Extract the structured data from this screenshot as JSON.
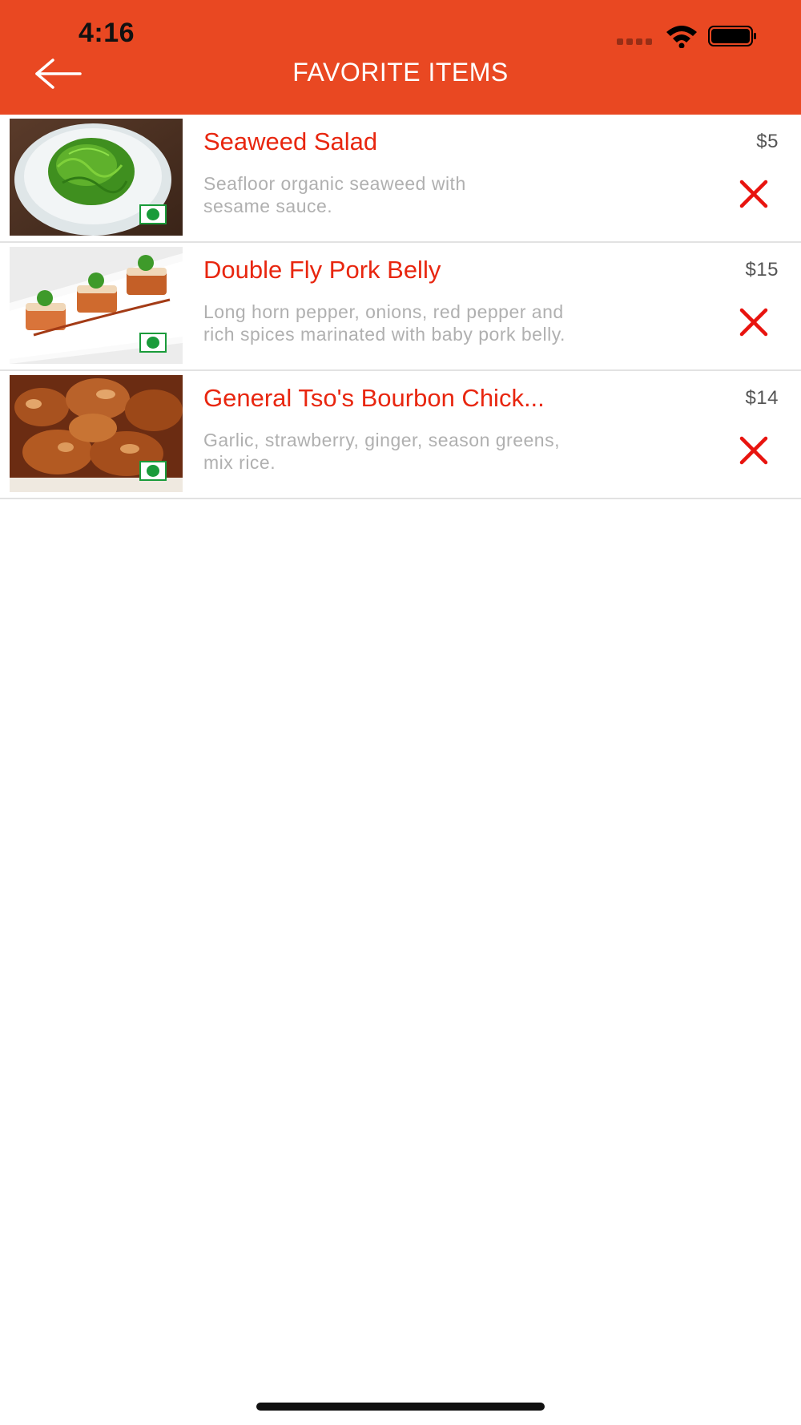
{
  "status_bar": {
    "time": "4:16"
  },
  "header": {
    "title": "FAVORITE ITEMS",
    "back_icon": "arrow-left-icon",
    "background_color": "#E94822"
  },
  "favorites": [
    {
      "name": "Seaweed Salad",
      "description_line1": "Seafloor organic seaweed with",
      "description_line2": "sesame sauce.",
      "price": "$5",
      "veg": true
    },
    {
      "name": "Double Fly Pork Belly",
      "description_line1": "Long horn pepper, onions, red pepper and",
      "description_line2": "rich spices marinated with baby pork belly.",
      "price": "$15",
      "veg": true
    },
    {
      "name": "General Tso's Bourbon Chick...",
      "description_line1": "Garlic, strawberry, ginger, season greens,",
      "description_line2": "mix rice.",
      "price": "$14",
      "veg": true
    }
  ],
  "colors": {
    "accent": "#E94822",
    "item_name": "#E8260F",
    "remove_icon": "#E8140F",
    "veg_badge": "#1a9b3a"
  }
}
